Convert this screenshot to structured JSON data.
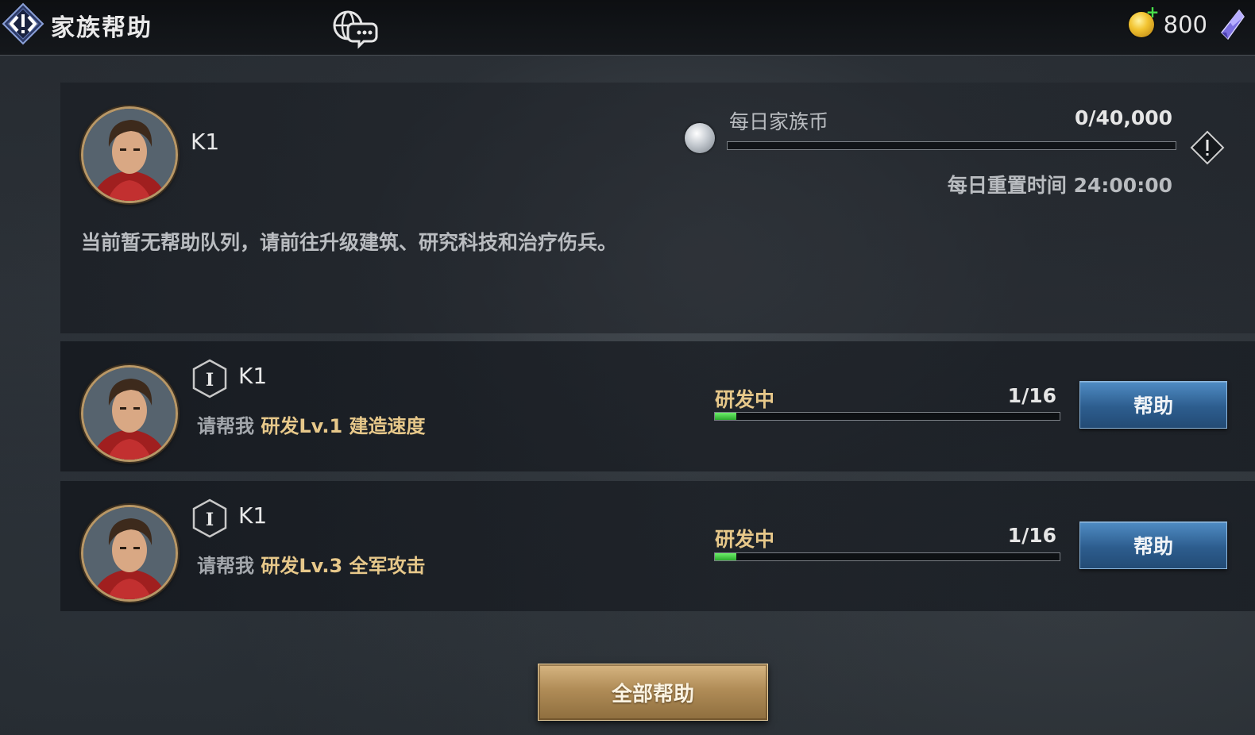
{
  "header": {
    "title": "家族帮助",
    "currency": {
      "amount": "800",
      "plus": "+"
    }
  },
  "summary": {
    "player_name": "K1",
    "daily": {
      "label": "每日家族币",
      "count": "0/40,000",
      "progress": 0,
      "reset_label": "每日重置时间 24:00:00"
    },
    "empty_message": "当前暂无帮助队列，请前往升级建筑、研究科技和治疗伤兵。"
  },
  "requests": [
    {
      "player_name": "K1",
      "rank": "I",
      "prefix": "请帮我",
      "task": "研发Lv.1 建造速度",
      "status": "研发中",
      "count": "1/16",
      "progress": 0.0625,
      "button": "帮助"
    },
    {
      "player_name": "K1",
      "rank": "I",
      "prefix": "请帮我",
      "task": "研发Lv.3 全军攻击",
      "status": "研发中",
      "count": "1/16",
      "progress": 0.0625,
      "button": "帮助"
    }
  ],
  "footer": {
    "help_all": "全部帮助"
  },
  "colors": {
    "accent_gold": "#e7c88a",
    "button_blue": "#2d5d8e",
    "progress_green": "#2ca92d"
  }
}
